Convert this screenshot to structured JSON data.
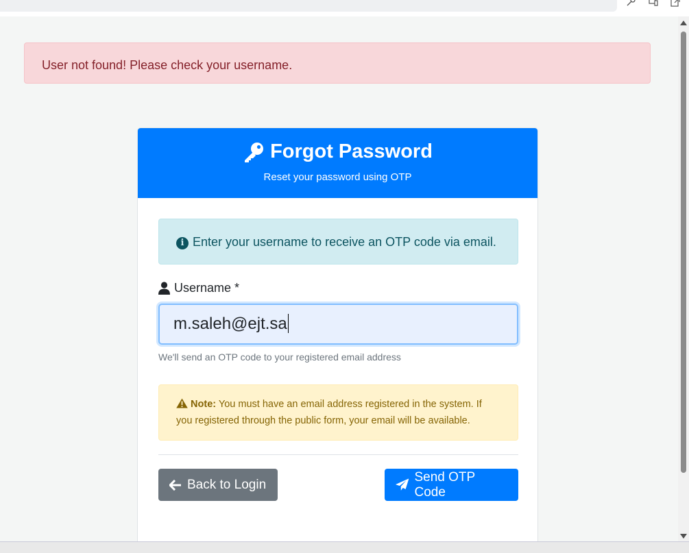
{
  "alert": {
    "message": "User not found! Please check your username."
  },
  "card": {
    "title": "Forgot Password",
    "subtitle": "Reset your password using OTP",
    "info": "Enter your username to receive an OTP code via email.",
    "username_label": "Username *",
    "username_value": "m.saleh@ejt.sa",
    "help_text": "We'll send an OTP code to your registered email address",
    "warning_label": "Note:",
    "warning_text": "You must have an email address registered in the system. If you registered through the public form, your email will be available.",
    "back_button": "Back to Login",
    "send_button": "Send OTP Code"
  },
  "icons": {
    "title": "key-icon",
    "info": "info-circle-icon",
    "user": "user-icon",
    "warning": "warning-triangle-icon",
    "back": "arrow-left-icon",
    "send": "paper-plane-icon"
  },
  "colors": {
    "primary": "#007bff",
    "secondary": "#6c757d",
    "danger_bg": "#f8d7da",
    "info_bg": "#d1ecf1",
    "warning_bg": "#fff3cd"
  }
}
